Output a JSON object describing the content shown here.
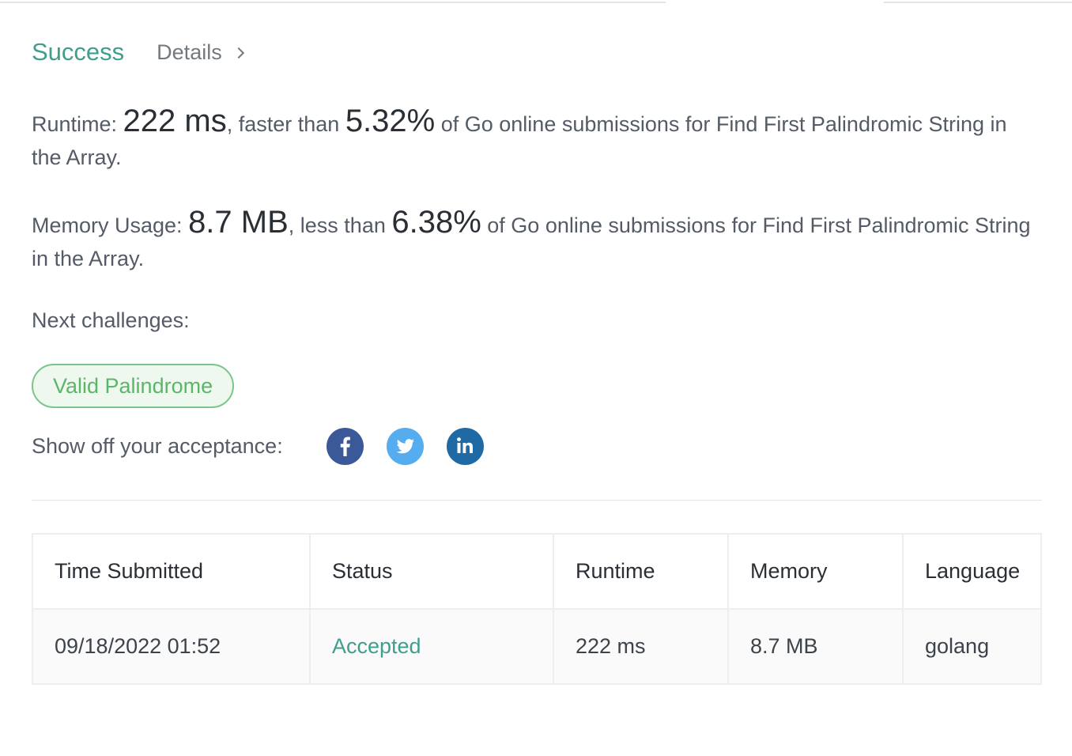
{
  "result": {
    "status": "Success",
    "details_label": "Details"
  },
  "runtime": {
    "prefix": "Runtime: ",
    "value": "222 ms",
    "mid": ", faster than ",
    "percent": "5.32%",
    "suffix": " of Go online submissions for Find First Palindromic String in the Array."
  },
  "memory": {
    "prefix": "Memory Usage: ",
    "value": "8.7 MB",
    "mid": ", less than ",
    "percent": "6.38%",
    "suffix": " of Go online submissions for Find First Palindromic String in the Array."
  },
  "next": {
    "label": "Next challenges:",
    "challenges": [
      "Valid Palindrome"
    ]
  },
  "share": {
    "label": "Show off your acceptance:",
    "icons": [
      "facebook-icon",
      "twitter-icon",
      "linkedin-icon"
    ],
    "colors": {
      "facebook": "#3b5998",
      "twitter": "#55acee",
      "linkedin": "#1f6aa4"
    }
  },
  "table": {
    "headers": [
      "Time Submitted",
      "Status",
      "Runtime",
      "Memory",
      "Language"
    ],
    "rows": [
      [
        "09/18/2022 01:52",
        "Accepted",
        "222 ms",
        "8.7 MB",
        "golang"
      ]
    ]
  },
  "colors": {
    "success": "#3f9e8c",
    "pill_text": "#5cb66a"
  }
}
